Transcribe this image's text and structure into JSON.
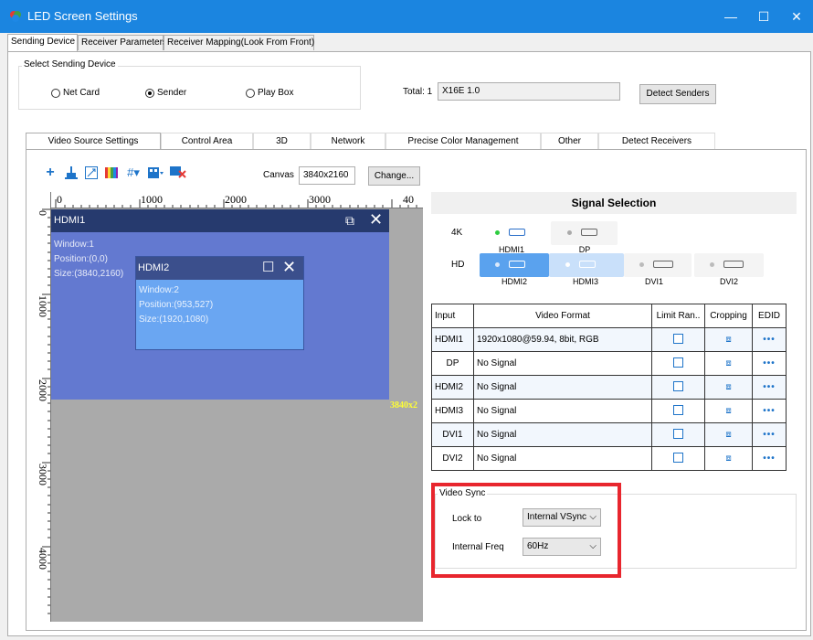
{
  "window": {
    "title": "LED Screen Settings",
    "minimize": "—",
    "maximize": "☐",
    "close": "✕"
  },
  "top_tabs": [
    "Sending Device",
    "Receiver Parameters",
    "Receiver Mapping(Look From Front)"
  ],
  "select_sending_device": {
    "label": "Select Sending Device",
    "options": [
      "Net Card",
      "Sender",
      "Play Box"
    ],
    "selected": "Sender",
    "total_label": "Total: 1",
    "device_value": "X16E  1.0",
    "detect_button": "Detect Senders"
  },
  "sub_tabs": [
    "Video Source Settings",
    "Control Area",
    "3D",
    "Network",
    "Precise Color Management",
    "Other",
    "Detect Receivers"
  ],
  "toolbar": {
    "icons": [
      "add-icon",
      "align-bottom-icon",
      "fit-icon",
      "color-bars-icon",
      "grid-icon",
      "layout-icon",
      "delete-icon"
    ],
    "canvas_label": "Canvas",
    "canvas_value": "3840x2160",
    "change_button": "Change..."
  },
  "ruler": {
    "top_labels": [
      "0",
      "1000",
      "2000",
      "3000",
      "40"
    ],
    "left_labels": [
      "0",
      "1000",
      "2000",
      "3000",
      "4000"
    ]
  },
  "windows": [
    {
      "title": "HDMI1",
      "lines": [
        "Window:1",
        "Position:(0,0)",
        "Size:(3840,2160)"
      ]
    },
    {
      "title": "HDMI2",
      "lines": [
        "Window:2",
        "Position:(953,527)",
        "Size:(1920,1080)"
      ]
    }
  ],
  "canvas_size_label": "3840x2",
  "signal_selection": {
    "title": "Signal Selection",
    "rows": [
      {
        "label": "4K",
        "inputs": [
          {
            "name": "HDMI1",
            "status": "active"
          },
          {
            "name": "DP",
            "status": "inactive"
          }
        ]
      },
      {
        "label": "HD",
        "inputs": [
          {
            "name": "HDMI2",
            "status": "selected"
          },
          {
            "name": "HDMI3",
            "status": "selected-light"
          },
          {
            "name": "DVI1",
            "status": "inactive"
          },
          {
            "name": "DVI2",
            "status": "inactive"
          }
        ]
      }
    ]
  },
  "video_table": {
    "headers": [
      "Input",
      "Video Format",
      "Limit Ran..",
      "Cropping",
      "EDID"
    ],
    "rows": [
      {
        "input": "HDMI1",
        "format": "1920x1080@59.94, 8bit, RGB"
      },
      {
        "input": "DP",
        "format": "No Signal"
      },
      {
        "input": "HDMI2",
        "format": "No Signal"
      },
      {
        "input": "HDMI3",
        "format": "No Signal"
      },
      {
        "input": "DVI1",
        "format": "No Signal"
      },
      {
        "input": "DVI2",
        "format": "No Signal"
      }
    ],
    "edid_text": "•••"
  },
  "video_sync": {
    "title": "Video Sync",
    "lock_to_label": "Lock to",
    "lock_to_value": "Internal VSync",
    "internal_freq_label": "Internal Freq",
    "internal_freq_value": "60Hz"
  },
  "colors": {
    "accent": "#1b85e0",
    "highlight_box": "#e8262e",
    "window1": "#6379d0",
    "window2": "#6aa6f2"
  }
}
